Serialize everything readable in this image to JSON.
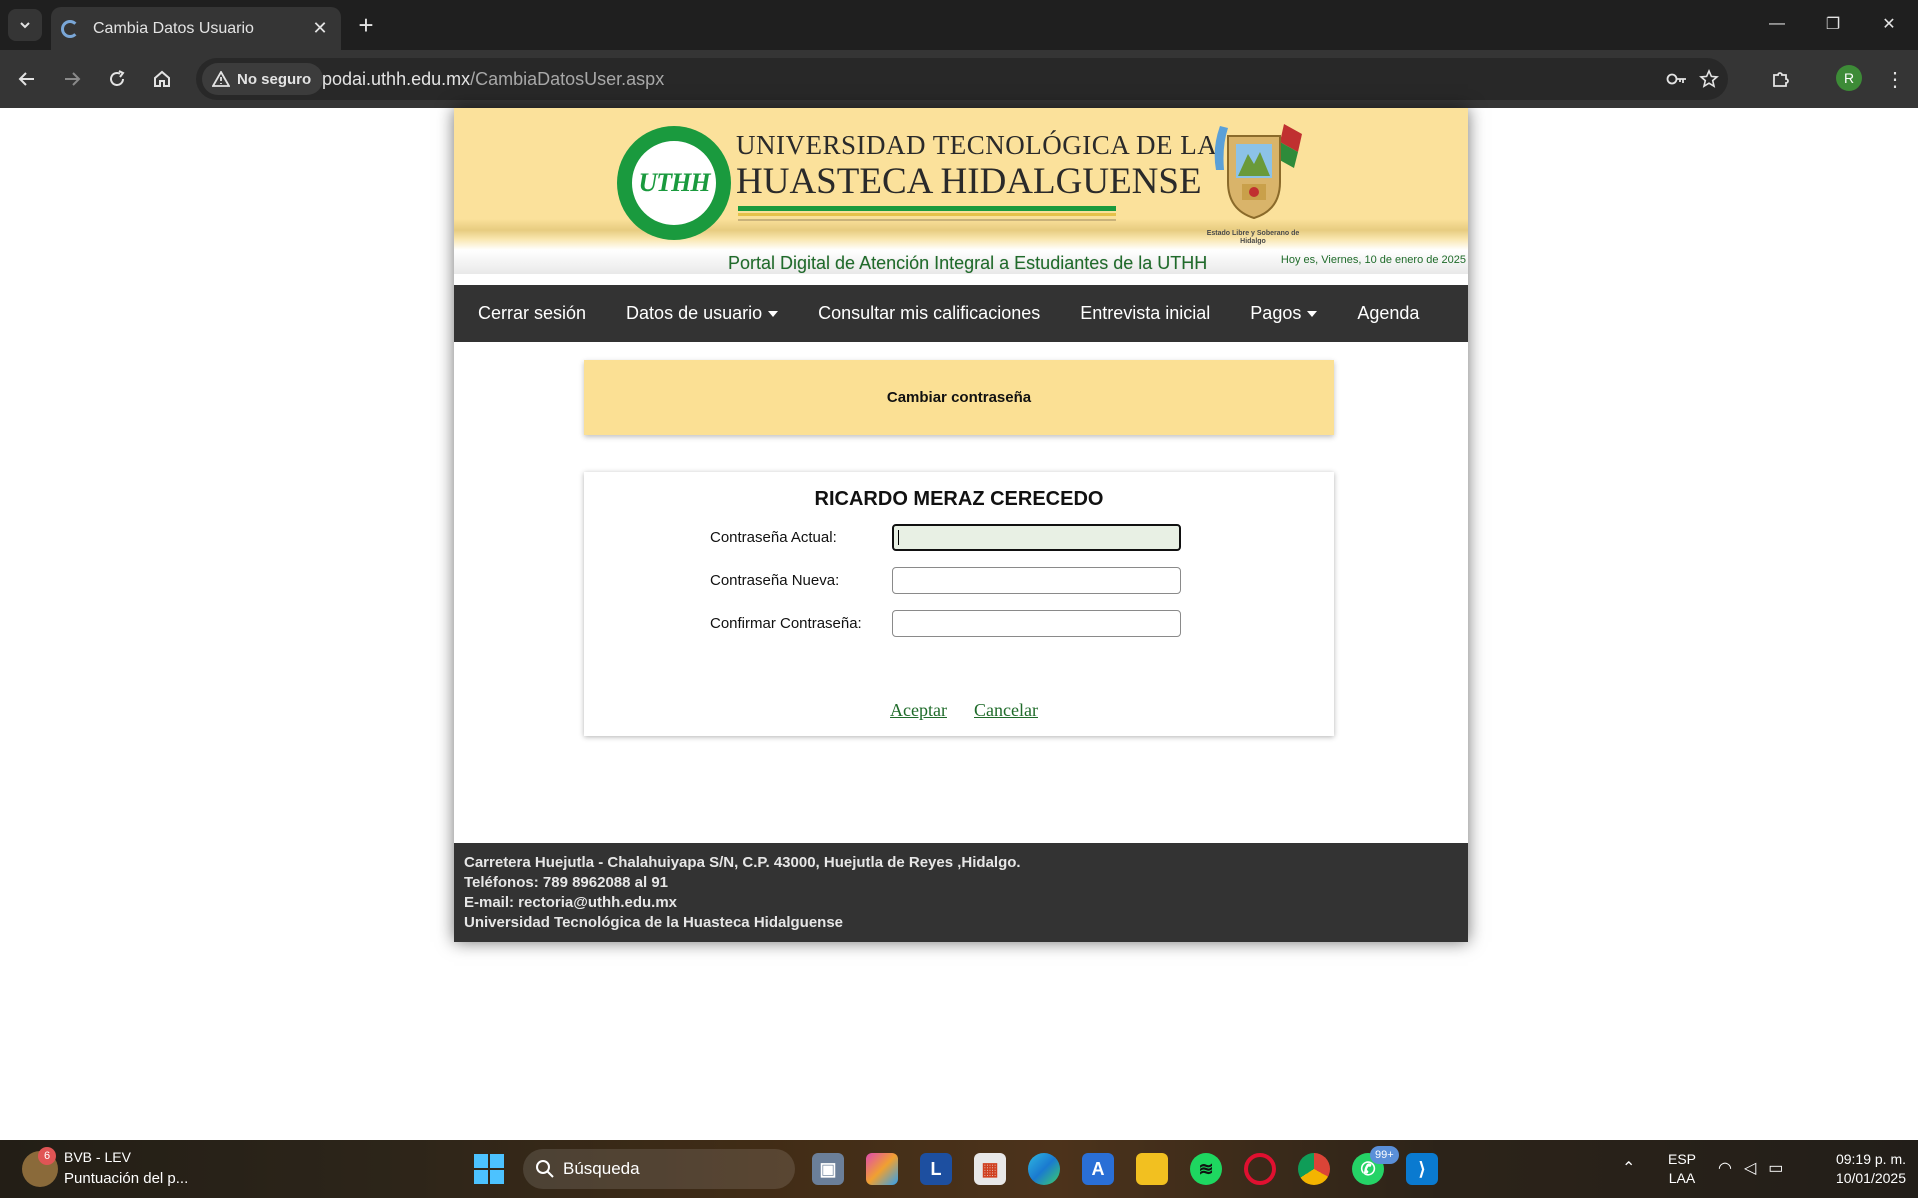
{
  "browser": {
    "tab_title": "Cambia Datos Usuario",
    "security_label": "No seguro",
    "url_host": "podai.uthh.edu.mx",
    "url_path": "/CambiaDatosUser.aspx",
    "profile_initial": "R"
  },
  "header": {
    "uni_line1": "UNIVERSIDAD TECNOLÓGICA DE LA",
    "uni_line2": "HUASTECA HIDALGUENSE",
    "seal_text": "UTHH",
    "coat_caption": "Estado Libre y Soberano de Hidalgo",
    "portal_title": "Portal Digital de Atención Integral a Estudiantes de la UTHH",
    "date_text": "Hoy es, Viernes, 10 de enero de 2025"
  },
  "nav": {
    "items": [
      {
        "label": "Cerrar sesión"
      },
      {
        "label": "Datos de usuario"
      },
      {
        "label": "Consultar mis calificaciones"
      },
      {
        "label": "Entrevista inicial"
      },
      {
        "label": "Pagos"
      },
      {
        "label": "Agenda"
      }
    ]
  },
  "notice": {
    "title": "Cambiar contraseña"
  },
  "form": {
    "user_name": "RICARDO MERAZ CERECEDO",
    "current_label": "Contraseña Actual:",
    "current_value": "",
    "new_label": "Contraseña Nueva:",
    "new_value": "",
    "confirm_label": "Confirmar Contraseña:",
    "confirm_value": "",
    "accept_label": "Aceptar",
    "cancel_label": "Cancelar"
  },
  "footer": {
    "lines": [
      "Carretera Huejutla - Chalahuiyapa S/N, C.P. 43000, Huejutla de Reyes ,Hidalgo.",
      "Teléfonos: 789 8962088 al 91",
      "E-mail: rectoria@uthh.edu.mx",
      "Universidad Tecnológica de la Huasteca Hidalguense"
    ]
  },
  "taskbar": {
    "weather_badge": "6",
    "media_title": "BVB - LEV",
    "media_subtitle": "Puntuación del p...",
    "search_placeholder": "Búsqueda",
    "whatsapp_badge": "99+",
    "lang_line1": "ESP",
    "lang_line2": "LAA",
    "time": "09:19 p. m.",
    "date": "10/01/2025"
  },
  "colors": {
    "banner_yellow": "#fbe19b",
    "nav_bg": "#333333",
    "link_green": "#1f6b2a",
    "brand_green": "#1a9a3e"
  }
}
